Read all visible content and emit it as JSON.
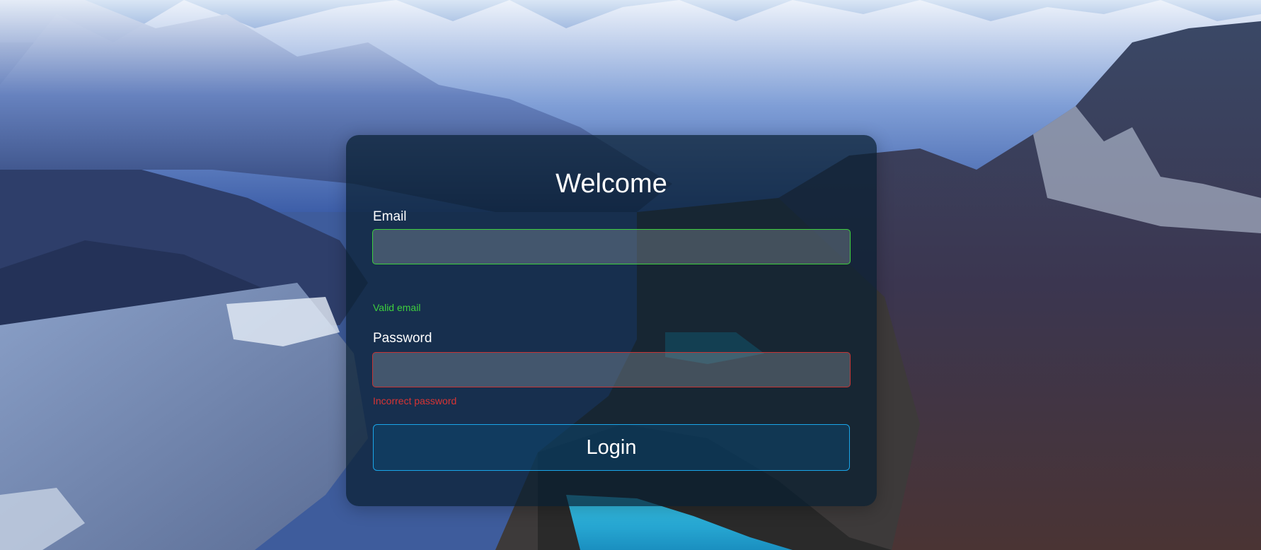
{
  "login": {
    "title": "Welcome",
    "email_label": "Email",
    "email_value": "",
    "email_hint": "Valid email",
    "password_label": "Password",
    "password_value": "",
    "password_hint": "Incorrect password",
    "login_button": "Login"
  },
  "colors": {
    "valid": "#3ecf3e",
    "invalid": "#d83434",
    "button_border": "#1aa5e8",
    "card_bg": "#081e30"
  }
}
